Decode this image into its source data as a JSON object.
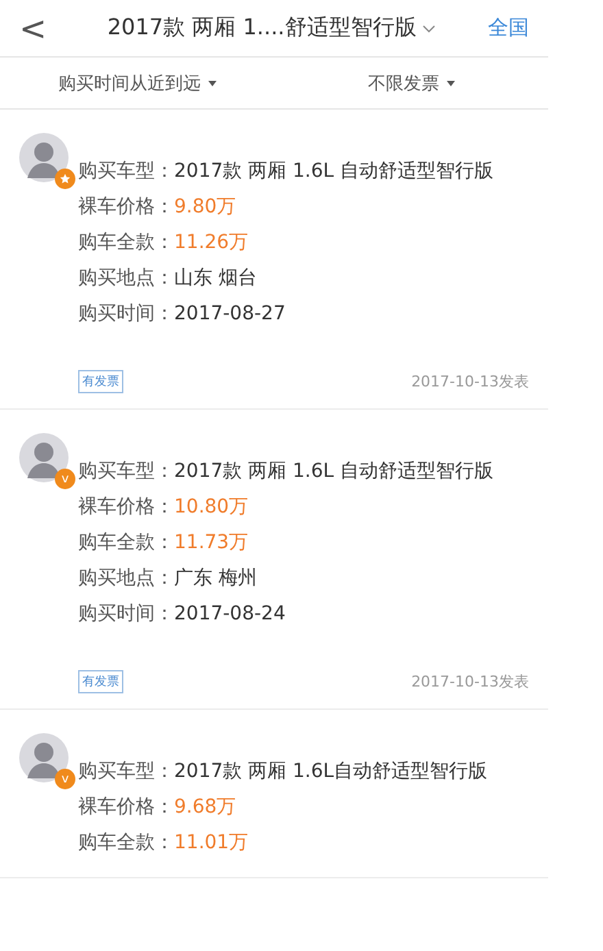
{
  "header": {
    "back": "<",
    "title": "2017款 两厢 1....舒适型智行版",
    "region": "全国"
  },
  "filters": [
    {
      "label": "购买时间从近到远"
    },
    {
      "label": "不限发票"
    }
  ],
  "posts": [
    {
      "avatar": {
        "badge": {
          "kind": "medal"
        }
      },
      "rows": [
        {
          "label": "购买车型：",
          "value": "2017款 两厢 1.6L 自动舒适型智行版",
          "kind": "plain"
        },
        {
          "label": "裸车价格：",
          "value": "9.80万",
          "kind": "price"
        },
        {
          "label": "购车全款：",
          "value": "11.26万",
          "kind": "price"
        },
        {
          "label": "购买地点：",
          "value": "山东 烟台",
          "kind": "plain"
        },
        {
          "label": "购买时间：",
          "value": "2017-08-27",
          "kind": "plain"
        }
      ],
      "tag": "有发票",
      "posted": "2017-10-13发表"
    },
    {
      "avatar": {
        "badge": {
          "kind": "letter",
          "text": "v"
        }
      },
      "rows": [
        {
          "label": "购买车型：",
          "value": "2017款 两厢 1.6L 自动舒适型智行版",
          "kind": "plain"
        },
        {
          "label": "裸车价格：",
          "value": "10.80万",
          "kind": "price"
        },
        {
          "label": "购车全款：",
          "value": "11.73万",
          "kind": "price"
        },
        {
          "label": "购买地点：",
          "value": "广东 梅州",
          "kind": "plain"
        },
        {
          "label": "购买时间：",
          "value": "2017-08-24",
          "kind": "plain"
        }
      ],
      "tag": "有发票",
      "posted": "2017-10-13发表"
    },
    {
      "avatar": {
        "badge": {
          "kind": "letter",
          "text": "v"
        }
      },
      "rows": [
        {
          "label": "购买车型：",
          "value": "2017款 两厢 1.6L自动舒适型智行版",
          "kind": "plain"
        },
        {
          "label": "裸车价格：",
          "value": "9.68万",
          "kind": "price"
        },
        {
          "label": "购车全款：",
          "value": "11.01万",
          "kind": "price"
        }
      ]
    }
  ]
}
